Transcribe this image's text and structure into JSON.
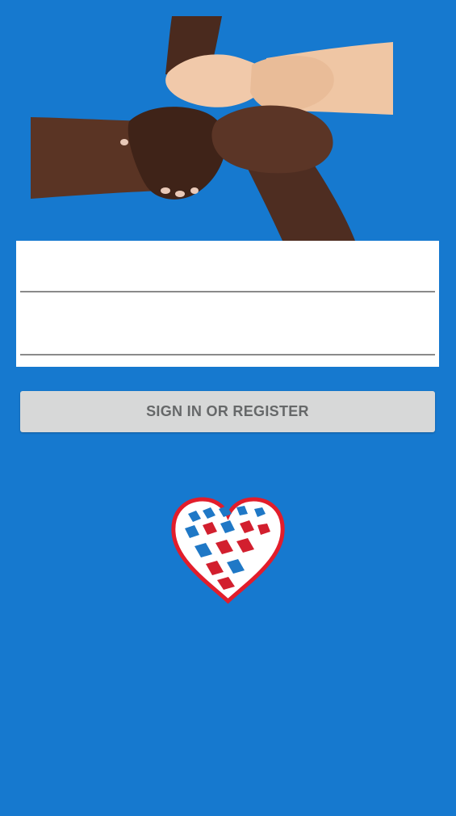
{
  "hero": {
    "image": "four-hands-gripping-wrists-image"
  },
  "login_form": {
    "username_value": "",
    "password_value": ""
  },
  "signin_button": {
    "label": "SIGN IN OR REGISTER"
  },
  "logo": {
    "icon": "heart-logo-icon",
    "colors": {
      "outline": "#e21d2b",
      "blue": "#1f78c6",
      "red": "#d21f2e"
    }
  },
  "theme": {
    "background": "#1679cf",
    "button_background": "#d7d8d8",
    "button_text": "#666869"
  }
}
